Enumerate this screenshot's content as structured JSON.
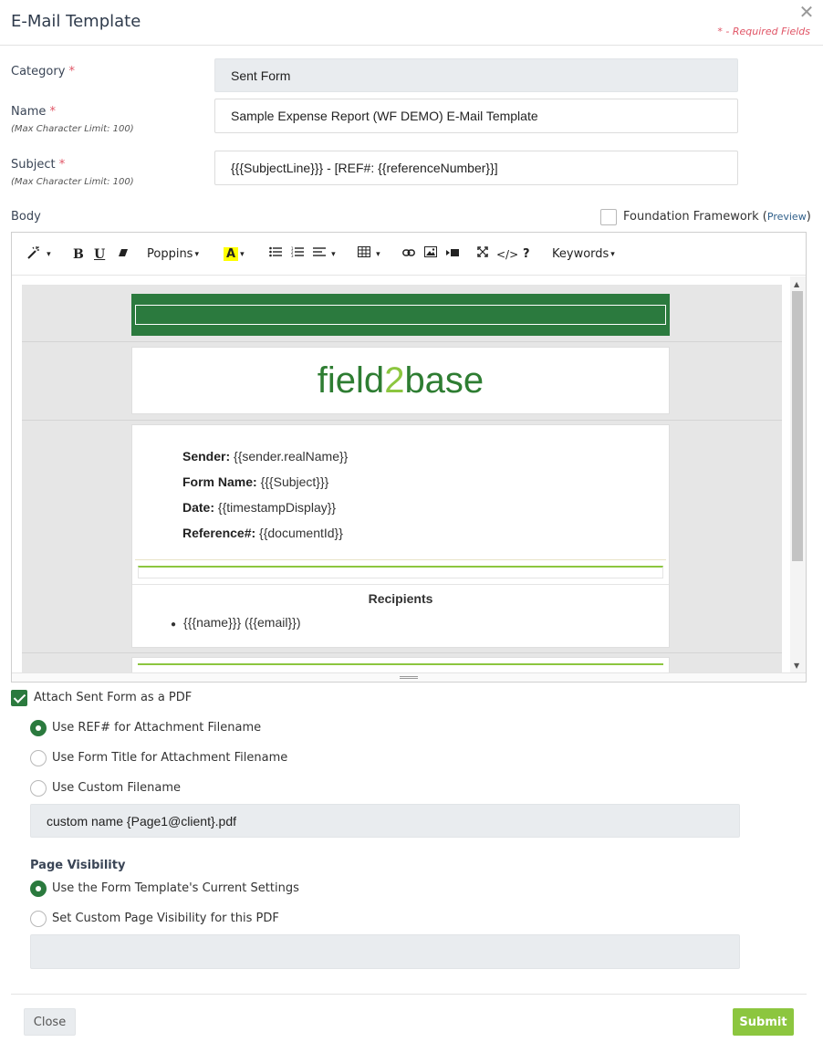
{
  "header": {
    "title": "E-Mail Template",
    "required_note": "* - Required Fields"
  },
  "form": {
    "category": {
      "label": "Category",
      "value": "Sent Form"
    },
    "name": {
      "label": "Name",
      "hint": "(Max Character Limit: 100)",
      "value": "Sample Expense Report (WF DEMO) E-Mail Template"
    },
    "subject": {
      "label": "Subject",
      "hint": "(Max Character Limit: 100)",
      "value": "{{{SubjectLine}}} - [REF#: {{referenceNumber}}]"
    },
    "body_label": "Body",
    "required_star": "*",
    "foundation": {
      "label": "Foundation Framework (",
      "preview": "Preview",
      "close": ")",
      "checked": false
    }
  },
  "toolbar": {
    "magic_icon": "✨",
    "bold": "B",
    "underline": "U",
    "eraser_icon": "eraser-icon",
    "font": "Poppins",
    "color": "A",
    "keywords": "Keywords",
    "help": "?",
    "code": "</>"
  },
  "email_body": {
    "brand_left": "field",
    "brand_num": "2",
    "brand_right": "base",
    "sender_label": "Sender:",
    "sender_value": " {{sender.realName}}",
    "form_name_label": "Form Name:",
    "form_name_value": " {{{Subject}}}",
    "date_label": "Date:",
    "date_value": " {{timestampDisplay}}",
    "ref_label": "Reference#:",
    "ref_value": " {{documentId}}",
    "recipients_title": "Recipients",
    "recipient_item": "{{{name}}} ({{email}})",
    "colors": {
      "header_green": "#2b7a3e",
      "brand_green": "#2e7d32",
      "accent_lime": "#8cc63f"
    }
  },
  "attachment": {
    "attach_label": "Attach Sent Form as a PDF",
    "attach_checked": true,
    "opt_ref": "Use REF# for Attachment Filename",
    "opt_title": "Use Form Title for Attachment Filename",
    "opt_custom": "Use Custom Filename",
    "custom_value": "custom name {Page1@client}.pdf",
    "page_visibility_title": "Page Visibility",
    "vis_current": "Use the Form Template's Current Settings",
    "vis_custom": "Set Custom Page Visibility for this PDF"
  },
  "footer": {
    "close_label": "Close",
    "submit_label": "Submit"
  }
}
